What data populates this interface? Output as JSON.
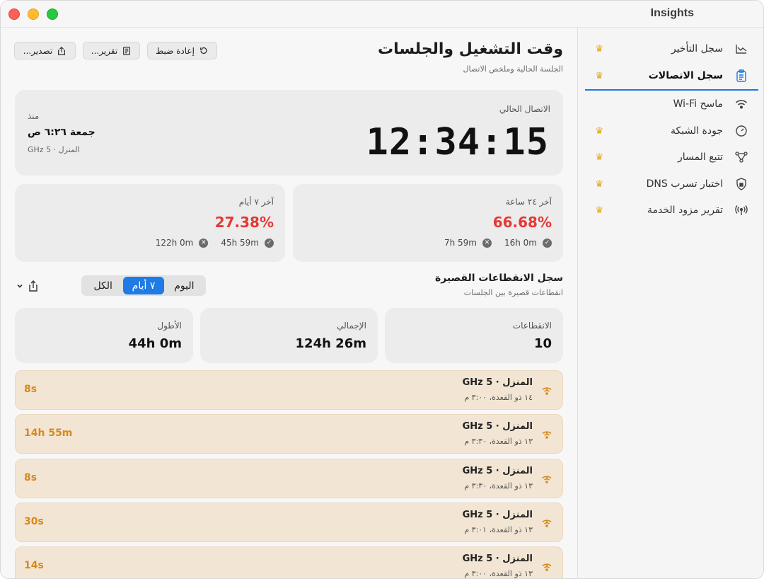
{
  "app": {
    "title": "Insights"
  },
  "sidebar": {
    "items": [
      {
        "label": "سجل التأخير",
        "icon": "chart-icon",
        "premium": true
      },
      {
        "label": "سجل الاتصالات",
        "icon": "clipboard-icon",
        "premium": true,
        "active": true
      },
      {
        "label": "ماسح Wi-Fi",
        "icon": "wifi-icon",
        "premium": false
      },
      {
        "label": "جودة الشبكة",
        "icon": "gauge-icon",
        "premium": true
      },
      {
        "label": "تتبع المسار",
        "icon": "route-icon",
        "premium": true
      },
      {
        "label": "اختبار تسرب DNS",
        "icon": "shield-icon",
        "premium": true
      },
      {
        "label": "تقرير مزود الخدمة",
        "icon": "antenna-icon",
        "premium": true
      }
    ]
  },
  "toolbar": {
    "reset_label": "إعادة ضبط",
    "report_label": "تقرير...",
    "export_label": "تصدير..."
  },
  "page": {
    "title": "وقت التشغيل والجلسات",
    "subtitle": "الجلسة الحالية وملخص الاتصال"
  },
  "current": {
    "label": "الاتصال الحالي",
    "time": "12:34:15",
    "since_label": "منذ",
    "since_value": "جمعة ٦:٢٦ ص",
    "network": "المنزل · 5 GHz"
  },
  "stats": [
    {
      "label": "آخر ٢٤ ساعة",
      "percent": "66.68%",
      "up": "16h 0m",
      "down": "7h 59m"
    },
    {
      "label": "آخر ٧ أيام",
      "percent": "27.38%",
      "up": "45h 59m",
      "down": "122h 0m"
    }
  ],
  "drops": {
    "title": "سجل الانقطاعات القصيرة",
    "subtitle": "انقطاعات قصيرة بين الجلسات",
    "segments": [
      "اليوم",
      "٧ أيام",
      "الكل"
    ],
    "selected_segment": "٧ أيام",
    "summary": [
      {
        "label": "الانقطاعات",
        "value": "10"
      },
      {
        "label": "الإجمالي",
        "value": "124h 26m"
      },
      {
        "label": "الأطول",
        "value": "44h 0m"
      }
    ],
    "rows": [
      {
        "network": "المنزل · 5 GHz",
        "date": "١٤ ذو القعدة، ٣:٠٠ م",
        "duration": "8s"
      },
      {
        "network": "المنزل · 5 GHz",
        "date": "١٣ ذو القعدة، ٣:٣٠ م",
        "duration": "14h 55m"
      },
      {
        "network": "المنزل · 5 GHz",
        "date": "١٣ ذو القعدة، ٣:٣٠ م",
        "duration": "8s"
      },
      {
        "network": "المنزل · 5 GHz",
        "date": "١٣ ذو القعدة، ٣:٠١ م",
        "duration": "30s"
      },
      {
        "network": "المنزل · 5 GHz",
        "date": "١٣ ذو القعدة، ٣:٠٠ م",
        "duration": "14s"
      }
    ]
  },
  "colors": {
    "accent": "#1f7be6",
    "danger": "#e53935",
    "warning": "#d48a1c",
    "row_bg": "#f3e5d3",
    "crown": "#e6a719"
  }
}
